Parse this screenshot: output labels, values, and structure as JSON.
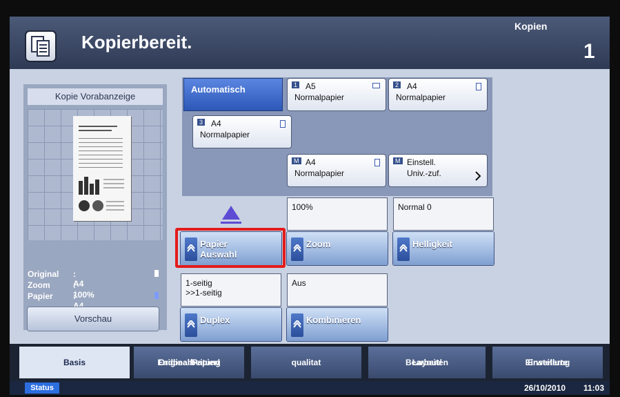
{
  "header": {
    "title": "Kopierbereit.",
    "copies_label": "Kopien",
    "copies_count": "1"
  },
  "preview": {
    "title": "Kopie Vorabanzeige",
    "original_label": "Original",
    "original_value": ": A4",
    "zoom_label": "Zoom",
    "zoom_value": ": 100%",
    "paper_label": "Papier",
    "paper_value": ": A4",
    "preview_button": "Vorschau"
  },
  "paper_source": {
    "auto_label": "Automatisch",
    "trays": [
      {
        "num": "1",
        "size": "A5",
        "kind": "Normalpapier"
      },
      {
        "num": "2",
        "size": "A4",
        "kind": "Normalpapier"
      },
      {
        "num": "3",
        "size": "A4",
        "kind": "Normalpapier"
      },
      {
        "num": "M",
        "size": "A4",
        "kind": "Normalpapier"
      }
    ],
    "manual_settings": {
      "num": "M",
      "line1": "Einstell.",
      "line2": "Univ.-zuf."
    }
  },
  "functions": {
    "paper_select": {
      "label_line1": "Papier",
      "label_line2": "Auswahl"
    },
    "zoom": {
      "value": "100%",
      "label": "Zoom"
    },
    "density": {
      "value": "Normal 0",
      "label": "Helligkeit"
    },
    "duplex": {
      "value_line1": "1-seitig",
      "value_line2": ">>1-seitig",
      "label": "Duplex"
    },
    "combine": {
      "value": "Aus",
      "label": "Kombinieren"
    }
  },
  "tabs": [
    {
      "line1": "Basis",
      "line2": ""
    },
    {
      "line1": "Original/Papier/",
      "line2": "Endbearbeitung"
    },
    {
      "line1": "qualitat",
      "line2": ""
    },
    {
      "line1": "Layout/",
      "line2": "Bearbeiten"
    },
    {
      "line1": "Erweiterte",
      "line2": "Einstellung"
    }
  ],
  "status": {
    "button": "Status",
    "date": "26/10/2010",
    "time": "11:03"
  },
  "colors": {
    "highlight": "#e31b1b",
    "accent": "#2d58b8"
  }
}
